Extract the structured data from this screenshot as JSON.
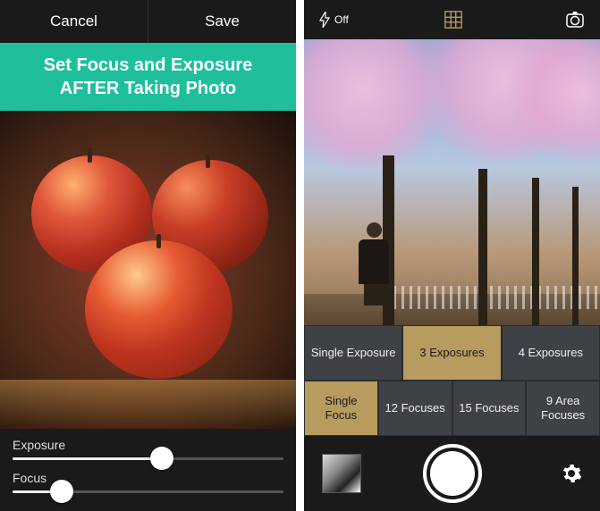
{
  "left": {
    "topbar": {
      "cancel": "Cancel",
      "save": "Save"
    },
    "banner_line1": "Set Focus and Exposure",
    "banner_line2": "AFTER Taking Photo",
    "sliders": {
      "exposure": {
        "label": "Exposure",
        "value": 55
      },
      "focus": {
        "label": "Focus",
        "value": 18
      }
    }
  },
  "right": {
    "flash_label": "Off",
    "segments": {
      "row1": [
        {
          "label": "Single Exposure",
          "selected": false
        },
        {
          "label": "3 Exposures",
          "selected": true
        },
        {
          "label": "4 Exposures",
          "selected": false
        }
      ],
      "row2": [
        {
          "label": "Single Focus",
          "selected": true
        },
        {
          "label": "12 Focuses",
          "selected": false
        },
        {
          "label": "15 Focuses",
          "selected": false
        },
        {
          "label": "9 Area Focuses",
          "selected": false
        }
      ]
    },
    "colors": {
      "accent": "#b79b5f"
    }
  }
}
